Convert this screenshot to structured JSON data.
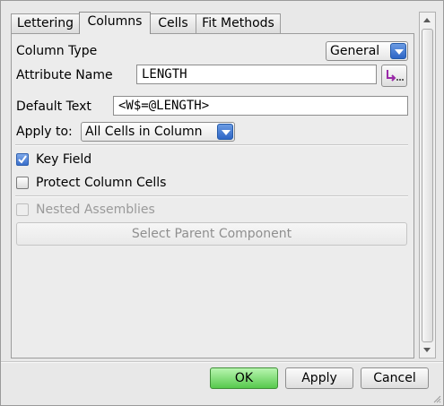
{
  "tabs": [
    "Lettering",
    "Columns",
    "Cells",
    "Fit Methods"
  ],
  "active_tab": "Columns",
  "column_type": {
    "label": "Column Type",
    "value": "General"
  },
  "attribute_name": {
    "label": "Attribute Name",
    "value": "LENGTH",
    "button_icon": "attribute-picker-icon"
  },
  "default_text": {
    "label": "Default Text",
    "value": "<W$=@LENGTH>"
  },
  "apply_to": {
    "label": "Apply to:",
    "value": "All Cells in Column"
  },
  "key_field": {
    "label": "Key Field",
    "checked": true
  },
  "protect_cells": {
    "label": "Protect Column Cells",
    "checked": false
  },
  "nested_assemblies": {
    "label": "Nested Assemblies",
    "checked": false,
    "enabled": false
  },
  "select_parent": {
    "label": "Select Parent Component",
    "enabled": false
  },
  "footer": {
    "ok": "OK",
    "apply": "Apply",
    "cancel": "Cancel"
  },
  "colors": {
    "ok_button": "#57c94d",
    "combo_arrow": "#2e66c6"
  }
}
